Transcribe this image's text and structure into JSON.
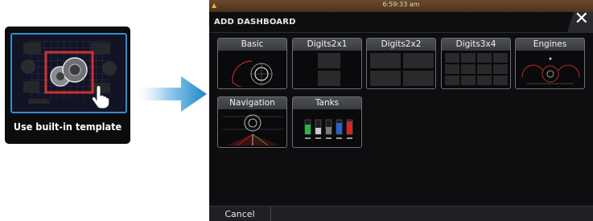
{
  "template_card": {
    "label": "Use built-in template"
  },
  "dashboard": {
    "status_time": "6:59:33 am",
    "title": "ADD DASHBOARD",
    "close_glyph": "✕",
    "cancel_label": "Cancel",
    "tiles": [
      {
        "label": "Basic"
      },
      {
        "label": "Digits2x1"
      },
      {
        "label": "Digits2x2"
      },
      {
        "label": "Digits3x4"
      },
      {
        "label": "Engines"
      },
      {
        "label": "Navigation"
      },
      {
        "label": "Tanks"
      }
    ]
  },
  "colors": {
    "accent": "#2e8fd0",
    "highlight": "#d03030",
    "screen_bg": "#0e0e10",
    "statusbar": "#5b3e24"
  },
  "icons": [
    "pointer-hand-icon",
    "right-arrow-icon",
    "close-icon",
    "warning-icon"
  ]
}
